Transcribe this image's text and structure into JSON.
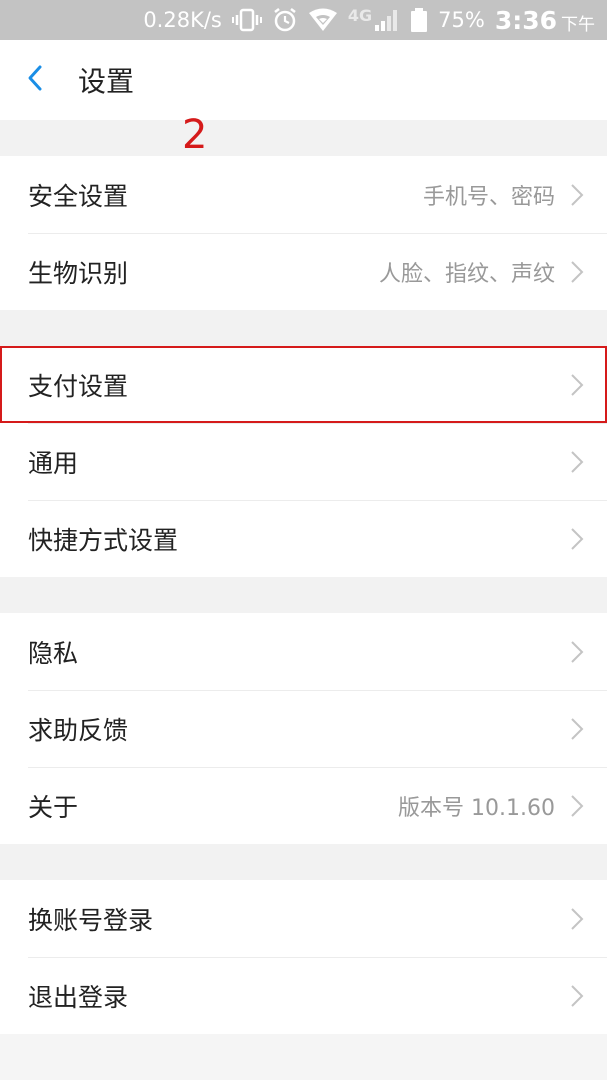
{
  "status_bar": {
    "speed": "0.28K/s",
    "network": "4G",
    "battery": "75%",
    "time": "3:36",
    "ampm": "下午",
    "icons": [
      "vibrate-icon",
      "alarm-icon",
      "wifi-icon",
      "signal-icon",
      "battery-icon"
    ]
  },
  "header": {
    "title": "设置",
    "back_icon": "chevron-left-icon"
  },
  "annotation": {
    "step_number": "2",
    "color": "#d51a1a"
  },
  "groups": [
    {
      "items": [
        {
          "label": "安全设置",
          "value": "手机号、密码"
        },
        {
          "label": "生物识别",
          "value": "人脸、指纹、声纹"
        }
      ]
    },
    {
      "items": [
        {
          "label": "支付设置",
          "value": "",
          "highlighted": true
        },
        {
          "label": "通用",
          "value": ""
        },
        {
          "label": "快捷方式设置",
          "value": ""
        }
      ]
    },
    {
      "items": [
        {
          "label": "隐私",
          "value": ""
        },
        {
          "label": "求助反馈",
          "value": ""
        },
        {
          "label": "关于",
          "value": "版本号 10.1.60"
        }
      ]
    },
    {
      "items": [
        {
          "label": "换账号登录",
          "value": ""
        },
        {
          "label": "退出登录",
          "value": ""
        }
      ]
    }
  ],
  "colors": {
    "accent": "#1a8ee6",
    "highlight": "#d51a1a",
    "status_bar_bg": "#c3c3c3"
  }
}
